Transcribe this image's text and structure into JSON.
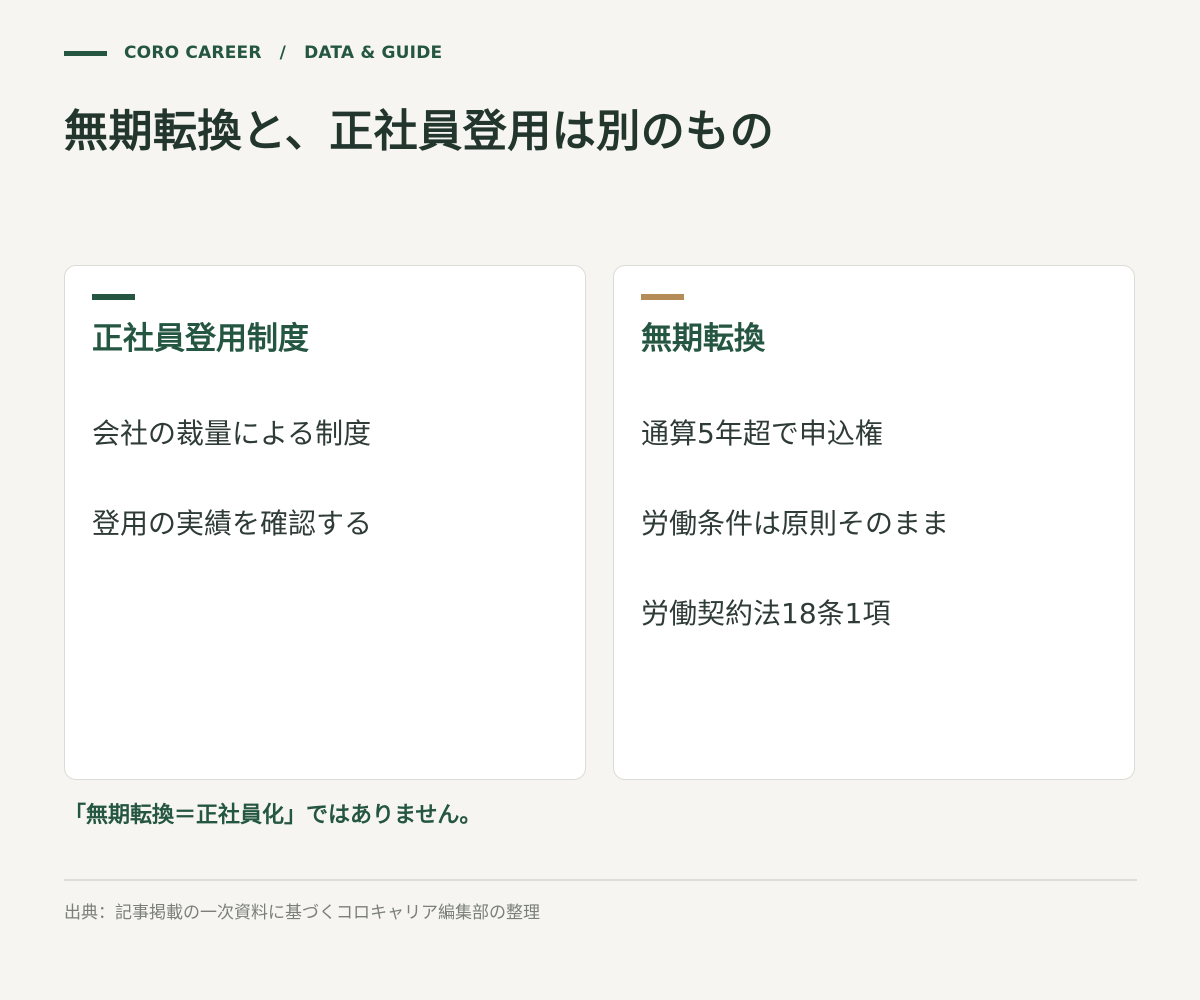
{
  "header": {
    "brand": "CORO CAREER",
    "separator": "/",
    "section": "DATA & GUIDE"
  },
  "title": "無期転換と、正社員登用は別のもの",
  "cards": [
    {
      "title": "正社員登用制度",
      "accent_color": "#245641",
      "items": [
        "会社の裁量による制度",
        "登用の実績を確認する"
      ]
    },
    {
      "title": "無期転換",
      "accent_color": "#b58b58",
      "items": [
        "通算5年超で申込権",
        "労働条件は原則そのまま",
        "労働契約法18条1項"
      ]
    }
  ],
  "note": "「無期転換＝正社員化」ではありません。",
  "source": "出典：記事掲載の一次資料に基づくコロキャリア編集部の整理",
  "colors": {
    "primary": "#245641",
    "accent_secondary": "#b58b58",
    "background": "#f6f5f1"
  }
}
